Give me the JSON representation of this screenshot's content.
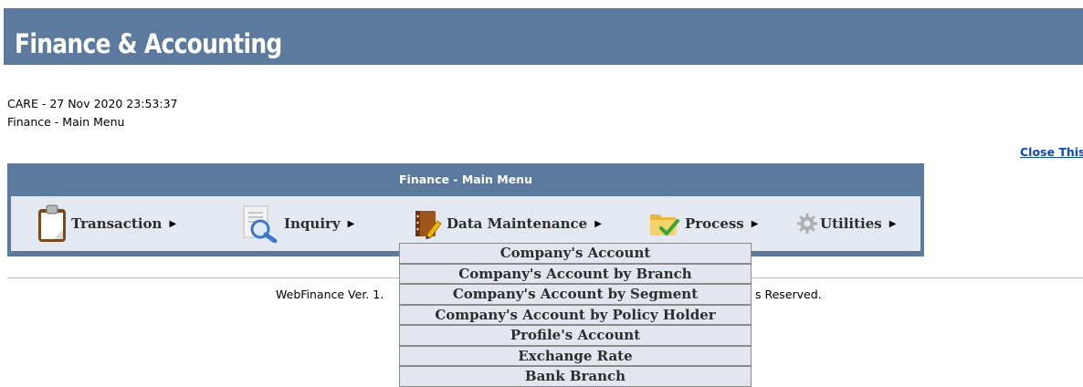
{
  "header": {
    "title": "Finance & Accounting"
  },
  "info": {
    "line1": "CARE - 27 Nov 2020 23:53:37",
    "line2": "Finance - Main Menu"
  },
  "close_link": "Close This Pag",
  "menu": {
    "caption": "Finance - Main Menu",
    "items": [
      {
        "label": "Transaction",
        "icon": "clipboard-icon"
      },
      {
        "label": "Inquiry",
        "icon": "document-search-icon"
      },
      {
        "label": "Data Maintenance",
        "icon": "notebook-pen-icon"
      },
      {
        "label": "Process",
        "icon": "folder-check-icon"
      },
      {
        "label": "Utilities",
        "icon": "gear-icon"
      }
    ]
  },
  "dropdown": {
    "items": [
      "Company's Account",
      "Company's Account by Branch",
      "Company's Account by Segment",
      "Company's Account by Policy Holder",
      "Profile's Account",
      "Exchange Rate",
      "Bank Branch"
    ]
  },
  "footer": {
    "left": "WebFinance Ver. 1.",
    "right": "s Reserved."
  },
  "colors": {
    "banner": "#5b7a9e",
    "menu_bar": "#e3e8f1",
    "link": "#0a49c9"
  }
}
